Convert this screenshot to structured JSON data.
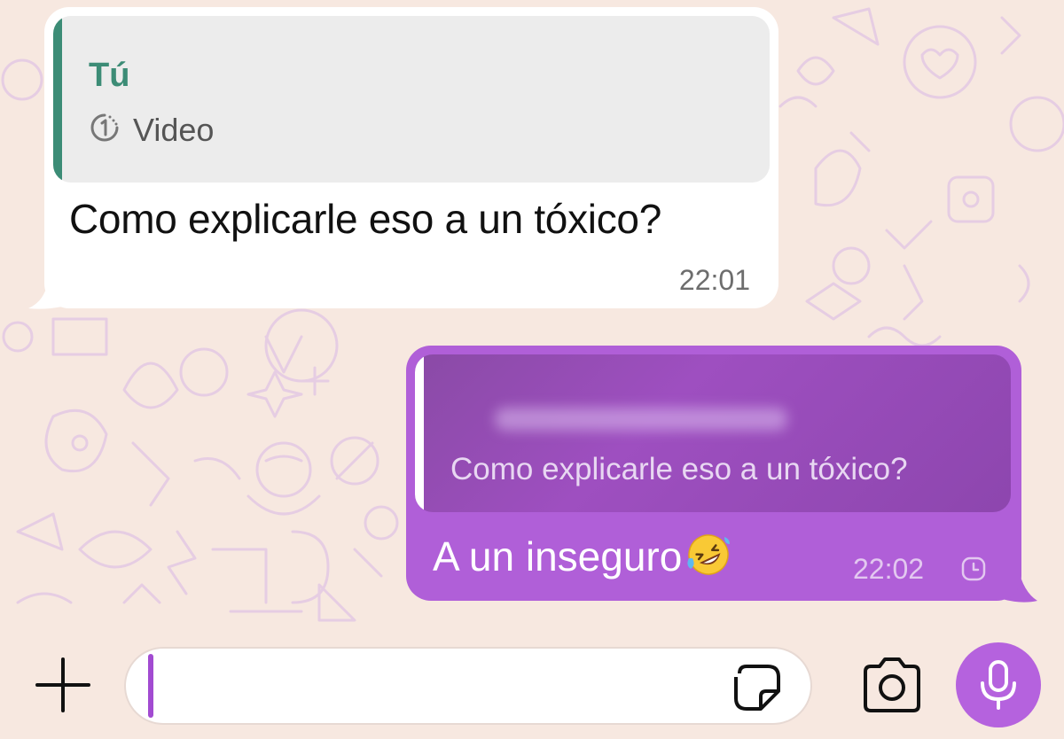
{
  "colors": {
    "wallpaper": "#f7e8e0",
    "incoming_bubble": "#ffffff",
    "incoming_quote_bg": "#ececec",
    "incoming_quote_accent": "#3c8c76",
    "outgoing_bubble": "#b05fd8",
    "outgoing_quote_bg": "#8d46ae",
    "mic_button": "#b562de"
  },
  "messages": {
    "incoming": {
      "quote": {
        "sender": "Tú",
        "kind_icon": "view-once-icon",
        "kind": "Video"
      },
      "text": "Como explicarle eso a un tóxico?",
      "time": "22:01"
    },
    "outgoing": {
      "quote": {
        "text": "Como explicarle eso a un tóxico?"
      },
      "text": "A un inseguro",
      "emoji_icon": "rolling-on-floor-laughing-emoji-icon",
      "time": "22:02",
      "status_icon": "clock-pending-icon"
    }
  },
  "composer": {
    "input_value": "",
    "attach_icon": "plus-icon",
    "sticker_icon": "sticker-icon",
    "camera_icon": "camera-icon",
    "mic_icon": "microphone-icon"
  }
}
